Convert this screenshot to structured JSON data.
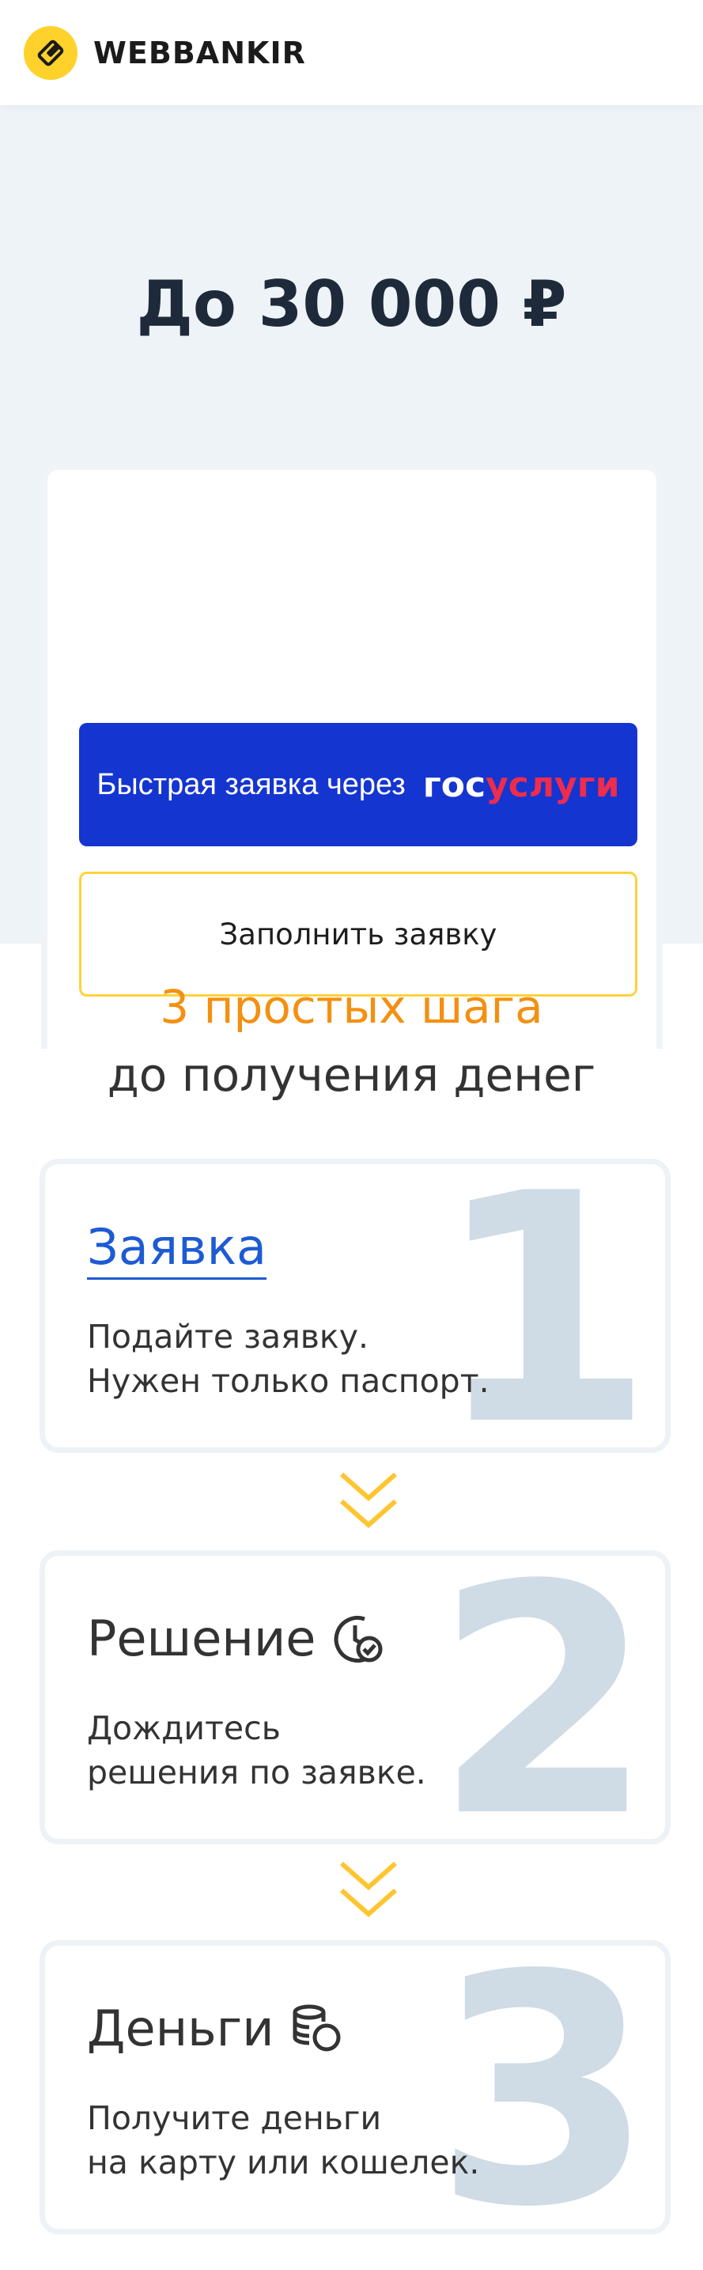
{
  "header": {
    "logo_icon": "wallet-diamond-icon",
    "brand_name": "WEBBANKIR"
  },
  "hero": {
    "amount_text": "До 30 000 ₽"
  },
  "form": {
    "gosuslugi_button": {
      "label": "Быстрая заявка через",
      "logo_part1": "гос",
      "logo_part2": "услуги"
    },
    "fill_button": {
      "label": "Заполнить заявку"
    }
  },
  "steps_section": {
    "title_line1": "3 простых шага",
    "title_line2": "до получения денег",
    "steps": [
      {
        "number": "1",
        "title": "Заявка",
        "desc_line1": "Подайте заявку.",
        "desc_line2": "Нужен только паспорт.",
        "icon": ""
      },
      {
        "number": "2",
        "title": "Решение",
        "desc_line1": "Дождитесь",
        "desc_line2": "решения по заявке.",
        "icon": "clock-check-icon"
      },
      {
        "number": "3",
        "title": "Деньги",
        "desc_line1": "Получите деньги",
        "desc_line2": "на карту или кошелек.",
        "icon": "coins-icon"
      }
    ],
    "arrow_icon": "double-chevron-down-icon"
  },
  "colors": {
    "accent_yellow": "#ffd12b",
    "gosuslugi_blue": "#1535d0",
    "gosuslugi_red": "#ee2c4d",
    "orange_title": "#f39011",
    "link_blue": "#1d5bd3",
    "step_number_gray": "#cfdbe5"
  }
}
